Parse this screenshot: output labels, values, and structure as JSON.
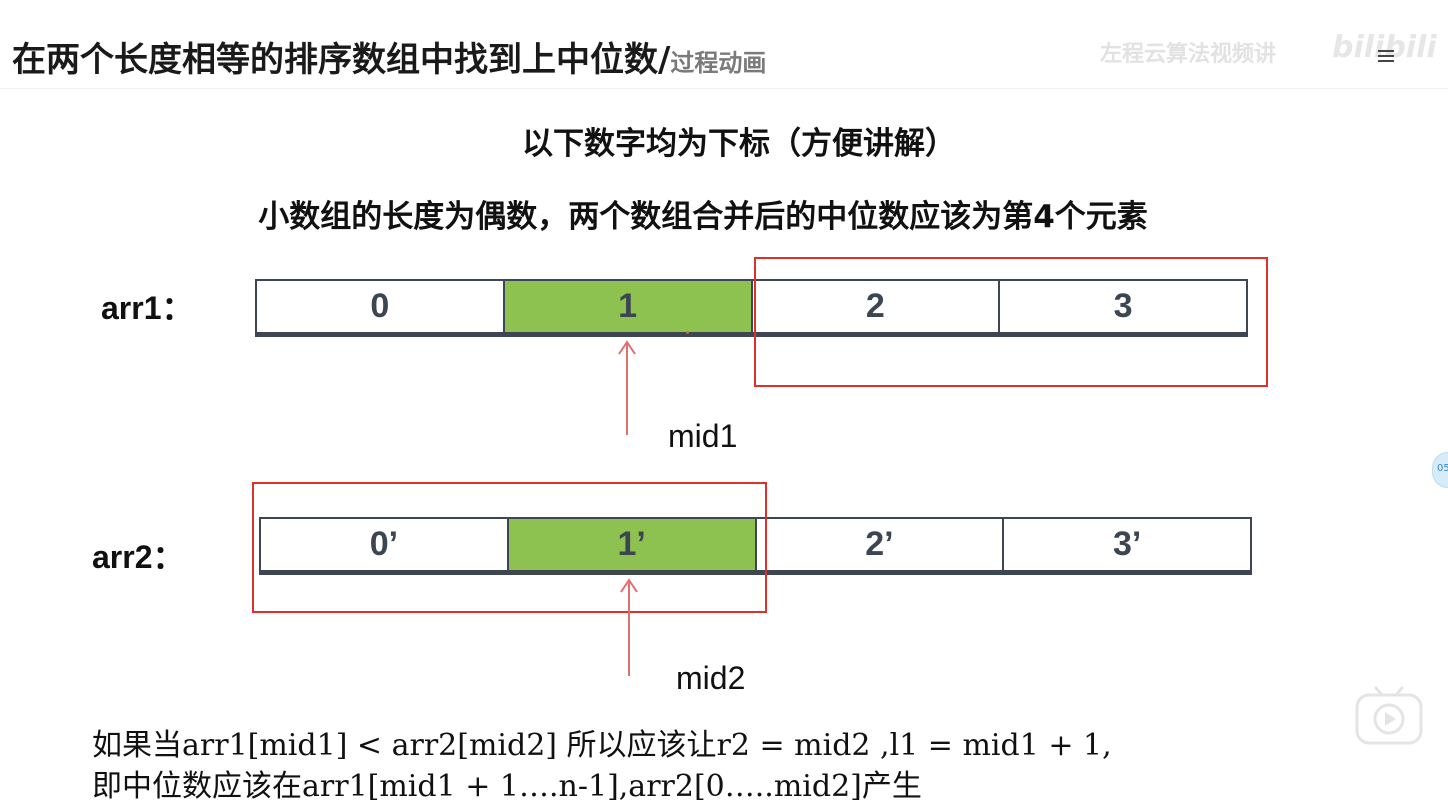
{
  "header": {
    "title": "在两个长度相等的排序数组中找到上中位数/",
    "subtitle": "过程动画"
  },
  "watermark": {
    "text": "左程云算法视频讲",
    "logo": "bilibili"
  },
  "side_badge": "05",
  "notes": {
    "line1": "以下数字均为下标（方便讲解）",
    "line2": "小数组的长度为偶数，两个数组合并后的中位数应该为第4个元素"
  },
  "arr1": {
    "label": "arr1：",
    "cells": [
      "0",
      "1",
      "2",
      "3"
    ],
    "highlight_index": 1,
    "pointer_label": "mid1"
  },
  "arr2": {
    "label": "arr2：",
    "cells": [
      "0’",
      "1’",
      "2’",
      "3’"
    ],
    "highlight_index": 1,
    "pointer_label": "mid2"
  },
  "explanation": {
    "line1": "如果当arr1[mid1] < arr2[mid2] 所以应该让r2 = mid2 ,l1 = mid1 + 1,",
    "line2": "即中位数应该在arr1[mid1 + 1….n-1],arr2[0…..mid2]产生"
  },
  "colors": {
    "highlight": "#8dc150",
    "box": "#e0302b",
    "arrow": "#e36e6e",
    "cell_border": "#3e4653"
  }
}
